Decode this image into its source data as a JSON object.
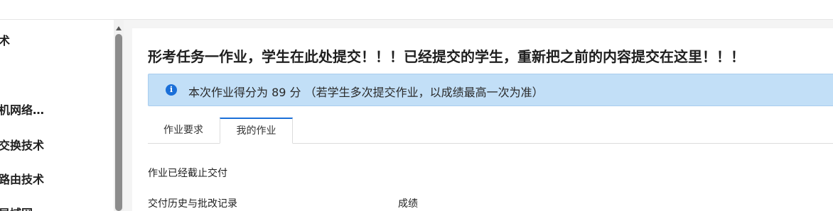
{
  "sidebar": {
    "items": [
      {
        "label": "术"
      },
      {
        "label": "机网络…"
      },
      {
        "label": "交换技术"
      },
      {
        "label": "路由技术"
      },
      {
        "label": "局域网"
      }
    ]
  },
  "main": {
    "title": "形考任务一作业，学生在此处提交！！！已经提交的学生，重新把之前的内容提交在这里！！！",
    "alert": {
      "icon": "info-icon",
      "text": "本次作业得分为 89 分 （若学生多次提交作业，以成绩最高一次为准）"
    },
    "tabs": [
      {
        "label": "作业要求",
        "active": false
      },
      {
        "label": "我的作业",
        "active": true
      }
    ],
    "status": "作业已经截止交付",
    "history_label": "交付历史与批改记录",
    "grade_label": "成绩"
  },
  "colors": {
    "accent": "#1a6fd8",
    "alert_bg": "#c2dff7"
  }
}
